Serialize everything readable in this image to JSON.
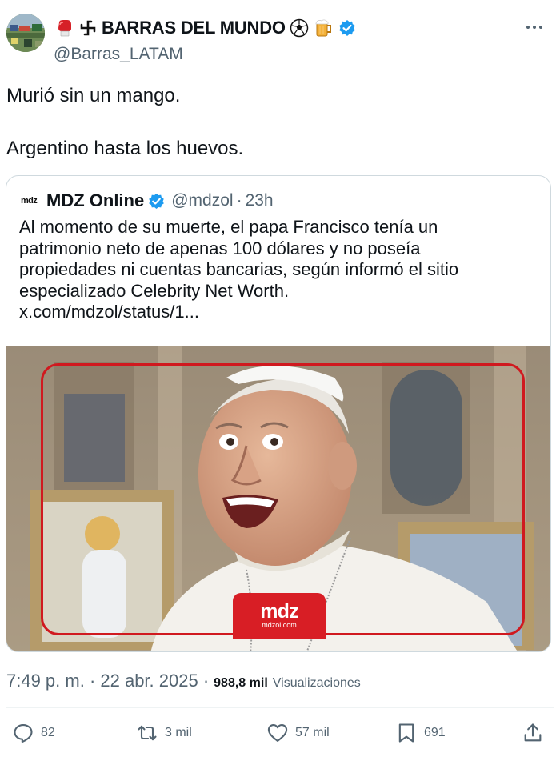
{
  "author": {
    "display_name": "BARRAS DEL MUNDO",
    "handle": "@Barras_LATAM",
    "name_emojis": [
      "boxing-glove",
      "sun-icon",
      "soccer-ball",
      "beer-mug"
    ],
    "verified": true
  },
  "tweet": {
    "lines": [
      "Murió sin un mango.",
      "Argentino hasta los huevos."
    ]
  },
  "quote": {
    "logo_text": "mdz",
    "name": "MDZ Online",
    "handle": "@mdzol",
    "separator": "·",
    "time": "23h",
    "verified": true,
    "text_lines": [
      "Al momento de su muerte, el papa Francisco tenía un",
      "patrimonio neto de apenas 100 dólares y no poseía",
      "propiedades ni cuentas bancarias, según informó el sitio",
      "especializado Celebrity Net Worth.",
      "x.com/mdzol/status/1..."
    ],
    "image": {
      "badge_text": "mdz",
      "badge_subtext": "mdzol.com"
    }
  },
  "meta": {
    "timestamp": "7:49 p. m. · 22 abr. 2025 ·",
    "views_count": "988,8 mil",
    "views_label": "Visualizaciones"
  },
  "actions": {
    "replies": "82",
    "reposts": "3 mil",
    "likes": "57 mil",
    "bookmarks": "691"
  },
  "colors": {
    "text": "#0f1419",
    "secondary": "#536471",
    "verified": "#1d9bf0",
    "border": "#cfd9de",
    "brand_red": "#d81e25"
  }
}
